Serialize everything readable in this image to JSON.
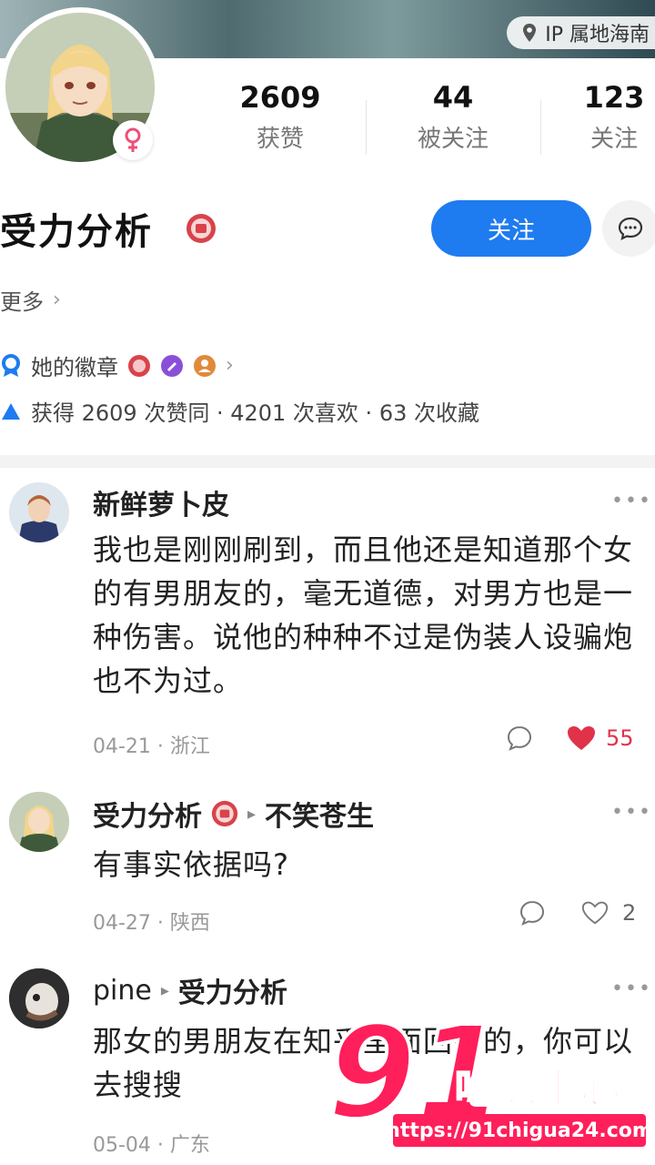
{
  "header": {
    "ip_label": "IP 属地海南"
  },
  "profile": {
    "name": "受力分析",
    "stats": [
      {
        "value": "2609",
        "label": "获赞"
      },
      {
        "value": "44",
        "label": "被关注"
      },
      {
        "value": "123",
        "label": "关注"
      }
    ],
    "follow_label": "关注",
    "more_label": "更多",
    "badges_label": "她的徽章",
    "achievements": "获得 2609 次赞同 · 4201 次喜欢 · 63 次收藏"
  },
  "comments": [
    {
      "author": "新鲜萝卜皮",
      "text": "我也是刚刚刷到，而且他还是知道那个女的有男朋友的，毫无道德，对男方也是一种伤害。说他的种种不过是伪装人设骗炮也不为过。",
      "meta": "04-21 · 浙江",
      "likes": "55",
      "liked": true
    },
    {
      "author": "受力分析",
      "reply_to": "不笑苍生",
      "text": "有事实依据吗?",
      "meta": "04-27 · 陕西",
      "likes": "2",
      "liked": false
    },
    {
      "author": "pine",
      "reply_to": "受力分析",
      "text": "那女的男朋友在知乎里面回答的，你可以去搜搜",
      "meta": "05-04 · 广东"
    }
  ],
  "watermark": {
    "number": "91",
    "text": "吃瓜中心",
    "url": "https://91chigua24.com"
  },
  "colors": {
    "accent": "#1e7bf0",
    "like": "#e0334a",
    "watermark": "#ff1f5a"
  }
}
